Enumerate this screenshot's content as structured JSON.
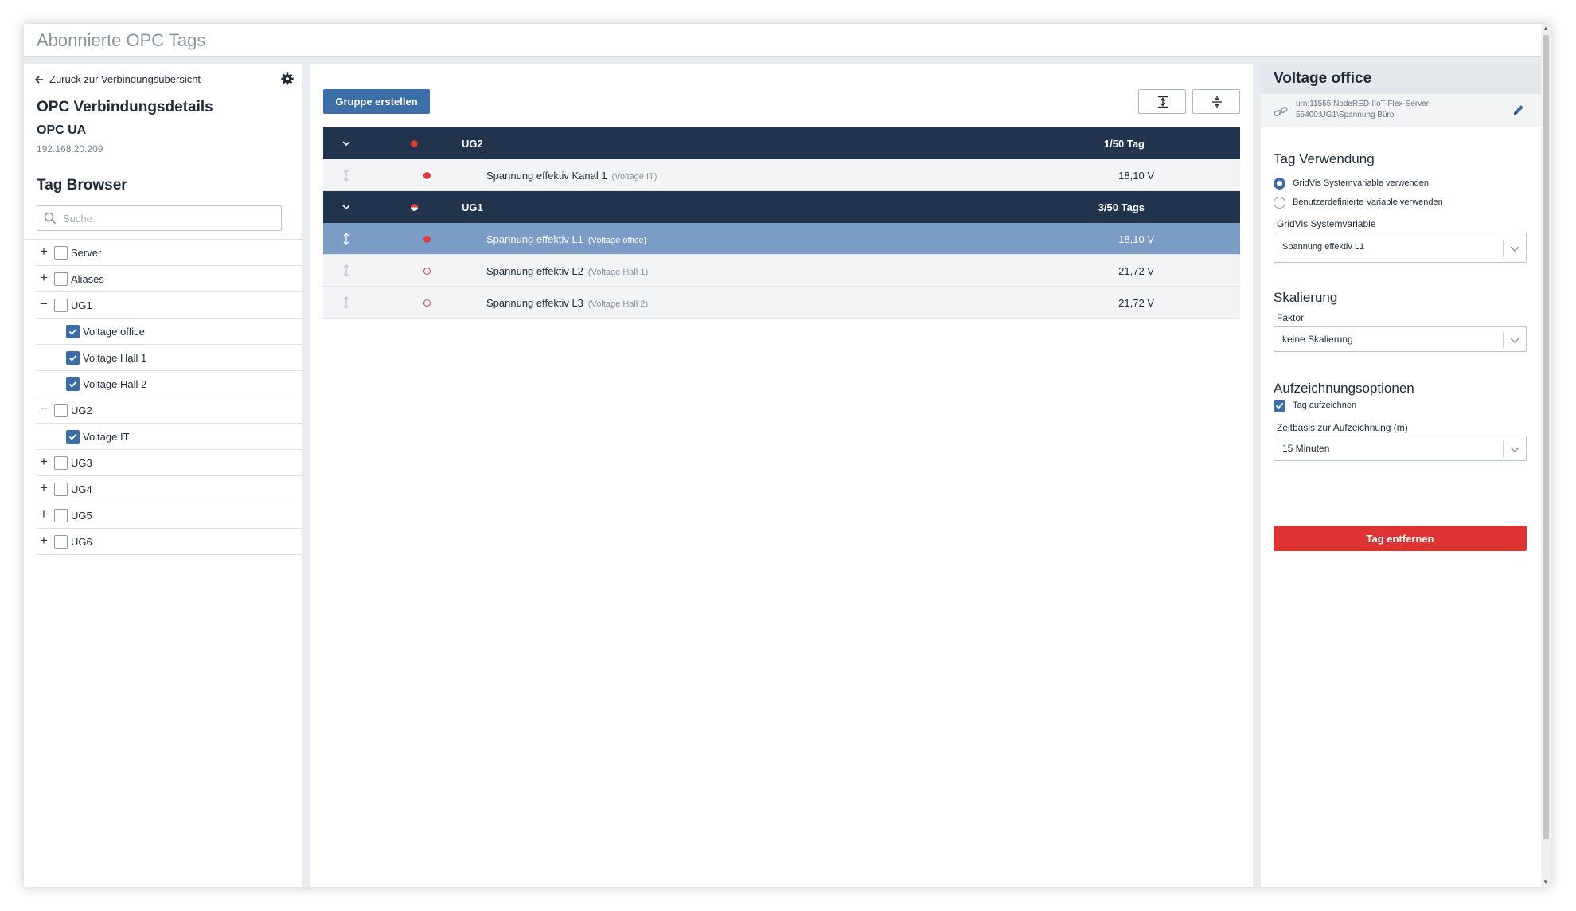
{
  "window": {
    "title": "Abonnierte OPC Tags"
  },
  "left": {
    "back_label": "Zurück zur Verbindungsübersicht",
    "conn_title": "OPC Verbindungsdetails",
    "conn_type": "OPC UA",
    "conn_ip": "192.168.20.209",
    "tag_browser_title": "Tag Browser",
    "search_placeholder": "Suche",
    "tree": [
      {
        "label": "Server",
        "toggle": "+",
        "checked": false,
        "level": 0
      },
      {
        "label": "Aliases",
        "toggle": "+",
        "checked": false,
        "level": 0
      },
      {
        "label": "UG1",
        "toggle": "−",
        "checked": false,
        "level": 0
      },
      {
        "label": "Voltage office",
        "checked": true,
        "level": 1
      },
      {
        "label": "Voltage Hall 1",
        "checked": true,
        "level": 1
      },
      {
        "label": "Voltage Hall 2",
        "checked": true,
        "level": 1
      },
      {
        "label": "UG2",
        "toggle": "−",
        "checked": false,
        "level": 0
      },
      {
        "label": "Voltage IT",
        "checked": true,
        "level": 1
      },
      {
        "label": "UG3",
        "toggle": "+",
        "checked": false,
        "level": 0
      },
      {
        "label": "UG4",
        "toggle": "+",
        "checked": false,
        "level": 0
      },
      {
        "label": "UG5",
        "toggle": "+",
        "checked": false,
        "level": 0
      },
      {
        "label": "UG6",
        "toggle": "+",
        "checked": false,
        "level": 0
      }
    ]
  },
  "center": {
    "create_group_label": "Gruppe erstellen",
    "groups": [
      {
        "name": "UG2",
        "count": "1/50 Tag",
        "status": "filled",
        "tags": [
          {
            "name": "Spannung effektiv Kanal 1",
            "alias": "(Voltage IT)",
            "value": "18,10 V",
            "status": "filled",
            "selected": false
          }
        ]
      },
      {
        "name": "UG1",
        "count": "3/50 Tags",
        "status": "half",
        "tags": [
          {
            "name": "Spannung effektiv L1",
            "alias": "(Voltage office)",
            "value": "18,10 V",
            "status": "filled",
            "selected": true
          },
          {
            "name": "Spannung effektiv L2",
            "alias": "(Voltage Hall 1)",
            "value": "21,72 V",
            "status": "hollow",
            "selected": false
          },
          {
            "name": "Spannung effektiv L3",
            "alias": "(Voltage Hall 2)",
            "value": "21,72 V",
            "status": "hollow",
            "selected": false
          }
        ]
      }
    ]
  },
  "right": {
    "title": "Voltage office",
    "urn": "urn:11555:NodeRED-IIoT-Flex-Server-55400:UG1\\Spannung Büro",
    "usage_title": "Tag Verwendung",
    "radio_system": "GridVis Systemvariable verwenden",
    "radio_custom": "Benutzerdefinierte Variable verwenden",
    "sysvar_label": "GridVis Systemvariable",
    "sysvar_value": "Spannung effektiv L1",
    "scaling_title": "Skalierung",
    "factor_label": "Faktor",
    "factor_value": "keine Skalierung",
    "record_title": "Aufzeichnungsoptionen",
    "record_checkbox": "Tag aufzeichnen",
    "timebase_label": "Zeitbasis zur Aufzeichnung (m)",
    "timebase_value": "15 Minuten",
    "remove_label": "Tag entfernen"
  },
  "colors": {
    "header_dark": "#22344d",
    "accent_blue": "#3c6fa8",
    "selected_row": "#7b9cc5",
    "status_red": "#e03a3a",
    "danger": "#dd3333"
  }
}
